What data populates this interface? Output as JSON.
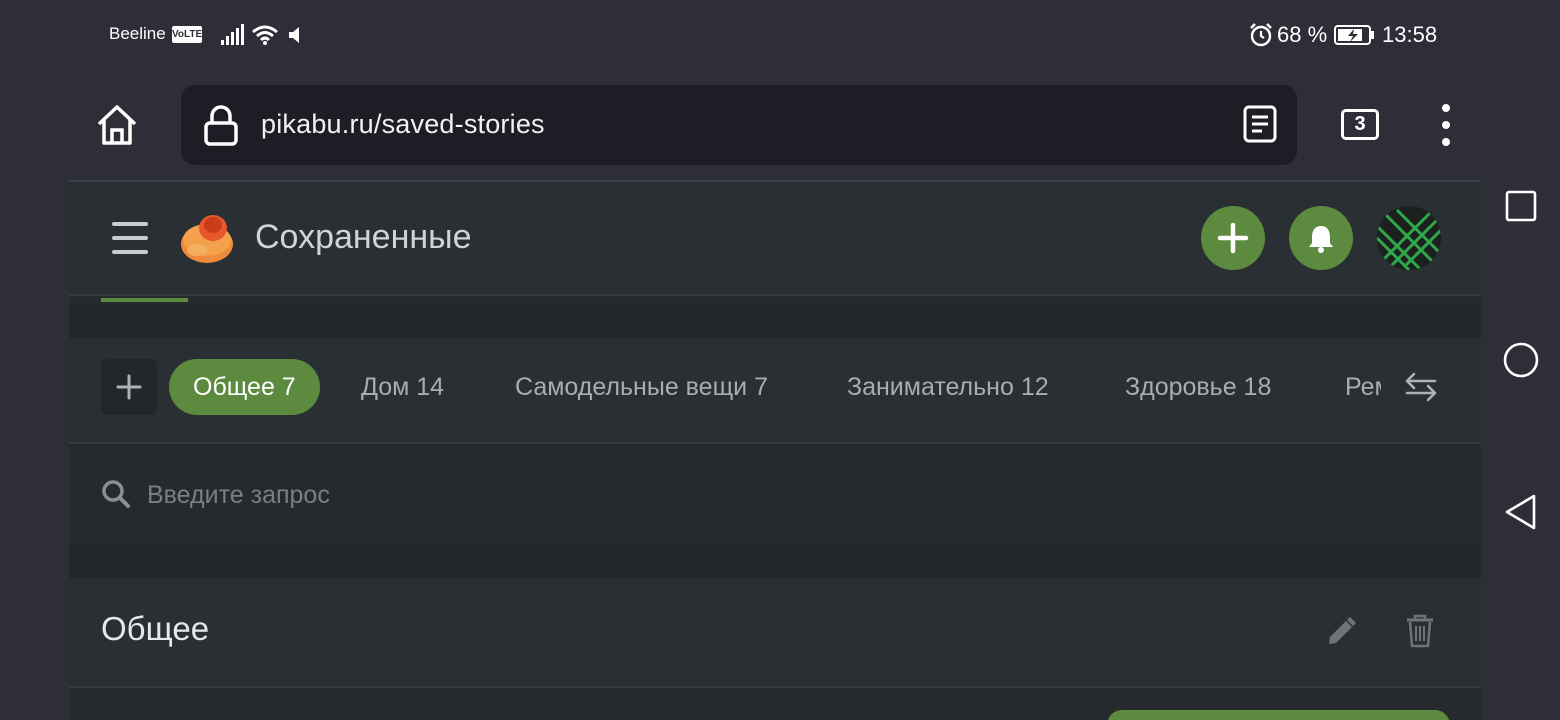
{
  "status_bar": {
    "carrier": "Beeline",
    "volte": "VoLTE",
    "battery_percent": "68 %",
    "time": "13:58",
    "icons": [
      "signal-icon",
      "wifi-icon",
      "mute-icon",
      "alarm-icon",
      "battery-charging-icon"
    ]
  },
  "browser": {
    "url": "pikabu.ru/saved-stories",
    "tab_count": "3",
    "icons": [
      "home-icon",
      "lock-icon",
      "reader-mode-icon",
      "more-vert-icon"
    ]
  },
  "header": {
    "title": "Сохраненные",
    "icons": [
      "hamburger-icon",
      "pikabu-logo",
      "plus-icon",
      "bell-icon",
      "avatar"
    ]
  },
  "tabs": [
    {
      "label": "Общее 7",
      "active": true
    },
    {
      "label": "Дом 14",
      "active": false
    },
    {
      "label": "Самодельные вещи 7",
      "active": false
    },
    {
      "label": "Занимательно 12",
      "active": false
    },
    {
      "label": "Здоровье 18",
      "active": false
    },
    {
      "label": "Рем",
      "active": false
    }
  ],
  "search": {
    "placeholder": "Введите запрос"
  },
  "section": {
    "title": "Общее",
    "icons": [
      "pencil-icon",
      "trash-icon"
    ]
  },
  "system_nav": {
    "icons": [
      "recents-icon",
      "home-circle-icon",
      "back-icon"
    ]
  },
  "colors": {
    "accent": "#5c8a3e",
    "background": "#2e2e39",
    "page_background": "#252a2d",
    "url_bar": "#1d1d25"
  }
}
